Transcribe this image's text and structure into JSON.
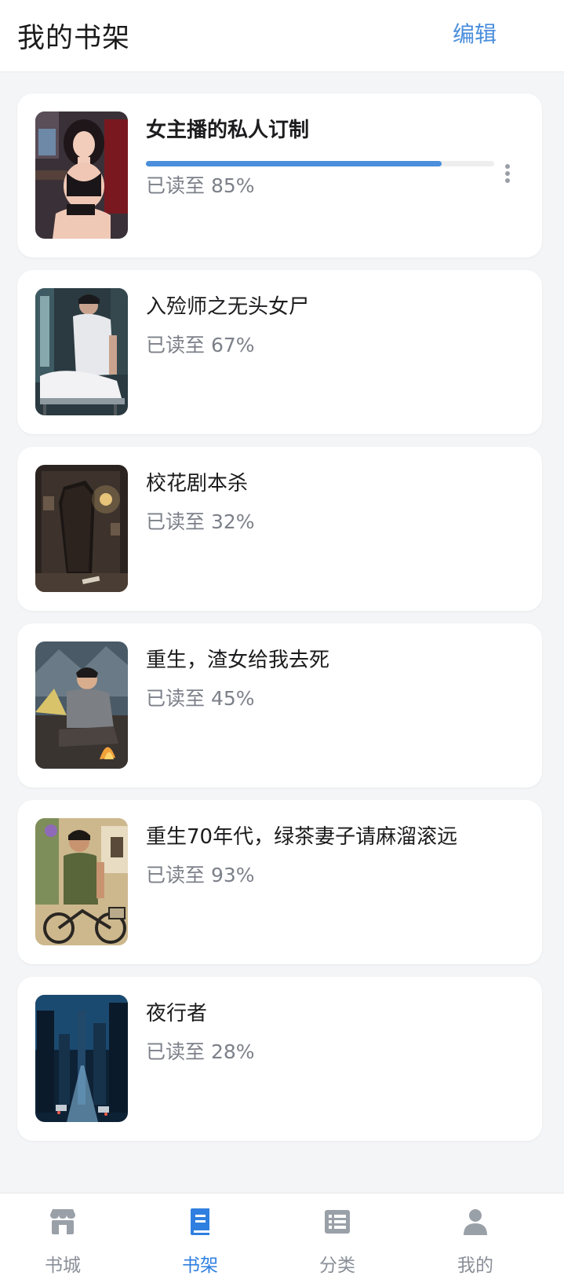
{
  "header": {
    "title": "我的书架",
    "edit_label": "编辑"
  },
  "books": [
    {
      "title": "女主播的私人订制",
      "read_text": "已读至 85%",
      "progress": 0.85,
      "cover_icon": "cover-streamer-girl"
    },
    {
      "title": "入殓师之无头女尸",
      "read_text": "已读至 67%",
      "progress": 0.67,
      "cover_icon": "cover-mortician"
    },
    {
      "title": "校花剧本杀",
      "read_text": "已读至 32%",
      "progress": 0.32,
      "cover_icon": "cover-dark-room-coffin"
    },
    {
      "title": "重生，渣女给我去死",
      "read_text": "已读至 45%",
      "progress": 0.45,
      "cover_icon": "cover-campfire-man"
    },
    {
      "title": "重生70年代，绿茶妻子请麻溜滚远",
      "read_text": "已读至 93%",
      "progress": 0.93,
      "cover_icon": "cover-bicycle-man"
    },
    {
      "title": "夜行者",
      "read_text": "已读至 28%",
      "progress": 0.28,
      "cover_icon": "cover-night-city"
    }
  ],
  "tabs": [
    {
      "label": "书城",
      "icon": "store-icon"
    },
    {
      "label": "书架",
      "icon": "book-icon",
      "active": true
    },
    {
      "label": "分类",
      "icon": "list-icon"
    },
    {
      "label": "我的",
      "icon": "user-icon"
    }
  ],
  "colors": {
    "accent": "#4a8edc",
    "tab_active": "#2f7fe0",
    "tab_inactive": "#9aa0a8"
  }
}
